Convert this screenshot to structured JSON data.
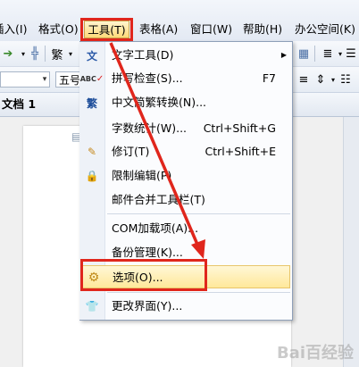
{
  "menubar": {
    "items": [
      {
        "label": "插入(I)",
        "visible": "插入(I)"
      },
      {
        "label": "格式(O)"
      },
      {
        "label": "工具(T)"
      },
      {
        "label": "表格(A)"
      },
      {
        "label": "窗口(W)"
      },
      {
        "label": "帮助(H)"
      },
      {
        "label": "办公空间(K)"
      }
    ],
    "partial_first": "插入(I)",
    "partial_first_visible": "插入(I)"
  },
  "toolbar": {
    "font_size": "五号",
    "traditional_btn": "繁"
  },
  "doc_tab": {
    "title": "文档 1"
  },
  "tools_menu": {
    "items": [
      {
        "label": "文字工具(D)",
        "shortcut": "",
        "icon": "text-tool-icon",
        "submenu": true
      },
      {
        "label": "拼写检查(S)...",
        "shortcut": "F7",
        "icon": "spellcheck-icon"
      },
      {
        "label": "中文简繁转换(N)...",
        "shortcut": "",
        "icon": "chinese-convert-icon"
      },
      {
        "label": "字数统计(W)...",
        "shortcut": "Ctrl+Shift+G",
        "icon": ""
      },
      {
        "label": "修订(T)",
        "shortcut": "Ctrl+Shift+E",
        "icon": "track-changes-icon"
      },
      {
        "label": "限制编辑(P)",
        "shortcut": "",
        "icon": "restrict-edit-icon"
      },
      {
        "label": "邮件合并工具栏(T)",
        "shortcut": "",
        "icon": ""
      },
      {
        "label": "COM加载项(A)...",
        "shortcut": "",
        "icon": ""
      },
      {
        "label": "备份管理(K)...",
        "shortcut": "",
        "icon": ""
      },
      {
        "label": "选项(O)...",
        "shortcut": "",
        "icon": "options-gear-icon",
        "highlighted": true
      },
      {
        "label": "更改界面(Y)...",
        "shortcut": "",
        "icon": "change-ui-icon"
      }
    ]
  },
  "watermark": "Bai百经验",
  "colors": {
    "annotation_red": "#e0261c",
    "highlight": "#ffe89a"
  }
}
